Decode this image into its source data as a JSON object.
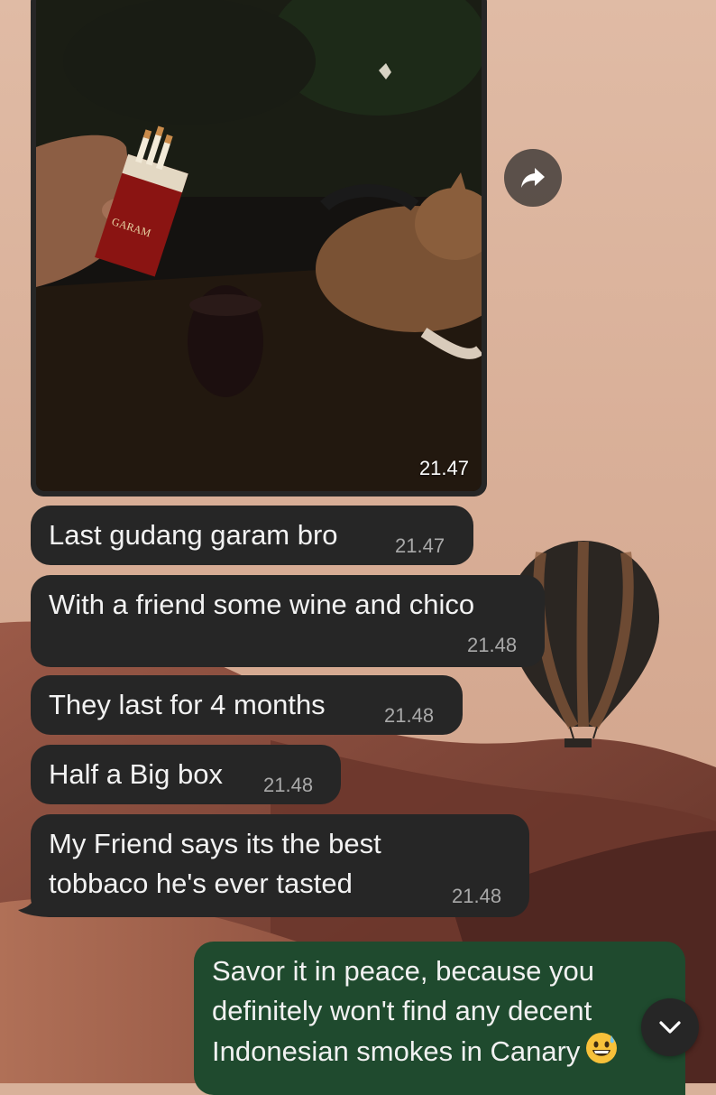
{
  "chat": {
    "media_message": {
      "time": "21.47"
    },
    "messages": [
      {
        "text": "Last gudang garam bro",
        "time": "21.47"
      },
      {
        "text": "With a friend some wine and chico",
        "time": "21.48"
      },
      {
        "text": "They last for 4 months",
        "time": "21.48"
      },
      {
        "text": "Half a Big box",
        "time": "21.48"
      },
      {
        "line1": "My Friend says its the best",
        "line2": "tobbaco he's ever tasted",
        "time": "21.48"
      }
    ],
    "outgoing": {
      "line1": "Savor it in peace, because you",
      "line2": "definitely won't find any decent",
      "line3": "Indonesian smokes in Canary",
      "emoji": "grinning-sweat-emoji"
    }
  },
  "photo": {
    "pack_label": "GARAM"
  },
  "icons": {
    "forward": "forward-arrow-icon",
    "scroll_down": "chevron-down-icon"
  },
  "colors": {
    "incoming_bubble": "#262626",
    "outgoing_bubble": "#1f4a2e",
    "wallpaper_sky": "#d8b19a",
    "wallpaper_dunes": "#8a4a3a"
  }
}
